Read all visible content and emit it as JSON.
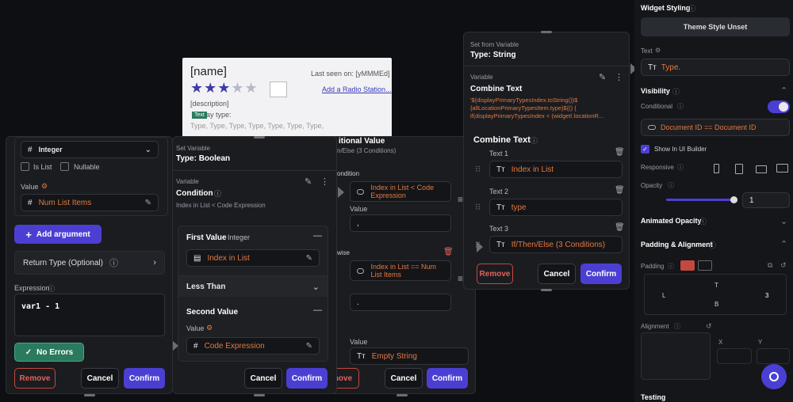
{
  "preview": {
    "name": "[name]",
    "last_seen": "Last seen on: [yMMMEd]",
    "add_radio": "Add a Radio Station...",
    "description": "[description]",
    "display_type": "ay type:",
    "text_tag": "Text",
    "type_line": "Type, Type, Type, Type, Type, Type, Type,"
  },
  "fn_panel": {
    "type_select": "Integer",
    "is_list": "Is List",
    "nullable": "Nullable",
    "value_label": "Value",
    "value": "Num List Items",
    "add_argument": "Add argument",
    "return_type": "Return Type (Optional)",
    "expression_label": "Expression",
    "expression": "var1 - 1",
    "no_errors": "No Errors",
    "remove": "Remove",
    "cancel": "Cancel",
    "confirm": "Confirm"
  },
  "bool_panel": {
    "header_label": "Set Variable",
    "header_type": "Type: Boolean",
    "var_label": "Variable",
    "condition": "Condition",
    "condition_desc": "Index in List < Code Expression",
    "first_value": "First Value",
    "first_type": "Integer",
    "first_field": "Index in List",
    "operator": "Less Than",
    "second_value": "Second Value",
    "value_label": "Value",
    "second_field": "Code Expression",
    "cancel": "Cancel",
    "confirm": "Confirm"
  },
  "cond_panel": {
    "title_part": "itional Value",
    "subtitle_part": "n/Else (3 Conditions)",
    "condition_part": "ondition",
    "f1": "Index in List < Code Expression",
    "value_label": "Value",
    "v1": ",",
    "otherwise_part": "wise",
    "f2": "Index in List == Num List Items",
    "v2": ".",
    "value3_label": "Value",
    "v3": "Empty String",
    "remove_part": "nove",
    "cancel": "Cancel",
    "confirm": "Confirm"
  },
  "str_panel": {
    "header_label": "Set from Variable",
    "header_type": "Type: String",
    "var_label": "Variable",
    "combine": "Combine Text",
    "code": "'${displayPrimaryTypesIndex.toString()}$ {allLocationPrimaryTypesItem.type}${() { if(displayPrimaryTypesIndex < (widget!.locationR...",
    "combine_title": "Combine Text",
    "t1_label": "Text 1",
    "t1": "Index in List",
    "t2_label": "Text 2",
    "t2": "type",
    "t3_label": "Text 3",
    "t3": "If/Then/Else (3 Conditions)",
    "remove": "Remove",
    "cancel": "Cancel",
    "confirm": "Confirm"
  },
  "right": {
    "widget_styling": "Widget Styling",
    "theme_style": "Theme Style Unset",
    "text_label": "Text",
    "text_value": "Type.",
    "visibility": "Visibility",
    "conditional": "Conditional",
    "cond_value": "Document ID == Document ID",
    "show_builder": "Show In UI Builder",
    "responsive": "Responsive",
    "opacity": "Opacity",
    "opacity_value": "1",
    "animated_opacity": "Animated Opacity",
    "padding_alignment": "Padding & Alignment",
    "padding": "Padding",
    "pad_left": "L",
    "pad_right": "3",
    "pad_top": "T",
    "pad_bottom": "B",
    "alignment": "Alignment",
    "x": "X",
    "y": "Y",
    "testing": "Testing"
  },
  "colors": {
    "accent": "#4b3fd3",
    "orange": "#e3793f",
    "remove": "#e0625a",
    "success": "#2a7a5e"
  }
}
